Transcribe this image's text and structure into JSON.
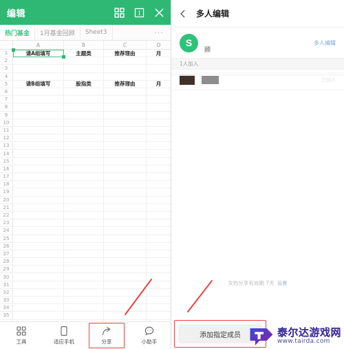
{
  "spreadsheet": {
    "appbar": {
      "title": "编辑",
      "icons": [
        {
          "name": "grid-view-icon",
          "glyph": "grid"
        },
        {
          "name": "sheet-count-icon",
          "label": "1"
        },
        {
          "name": "close-icon",
          "glyph": "x"
        }
      ]
    },
    "tabs": [
      {
        "label": "热门基金",
        "active": true
      },
      {
        "label": "1月基金回顾",
        "active": false
      },
      {
        "label": "Sheet3",
        "active": false
      }
    ],
    "tabs_more": "···",
    "columns": [
      "A",
      "B",
      "C",
      "D"
    ],
    "row_count_visible": 38,
    "selected_cell": "A1",
    "cells": {
      "1": [
        "请A组填写",
        "主题类",
        "推荐理由",
        "月"
      ],
      "5": [
        "请B组填写",
        "股指类",
        "推荐理由",
        "月"
      ]
    },
    "toolbar": [
      {
        "label": "工具",
        "icon": "tools-grid-icon",
        "highlighted": false
      },
      {
        "label": "适应手机",
        "icon": "phone-fit-icon",
        "highlighted": false
      },
      {
        "label": "分享",
        "icon": "share-icon",
        "highlighted": true
      },
      {
        "label": "小助手",
        "icon": "assistant-smiley-icon",
        "highlighted": false
      }
    ]
  },
  "share_panel": {
    "back_icon": "back-chevron-icon",
    "title": "多人编辑",
    "owner": {
      "avatar_letter": "S",
      "name": "顾",
      "action_link": "多人编辑"
    },
    "section_header": "1人加入",
    "member": {
      "status": "已加入"
    },
    "validity": {
      "text": "文档分享有效期 7天",
      "settings_link": "设置"
    },
    "add_member_button": "添加指定成员"
  },
  "watermark": {
    "cn": "泰尔达游戏网",
    "url": "www.tairda.com"
  },
  "colors": {
    "brand_green": "#2fb874",
    "accent_green": "#43c286",
    "annotation_red": "#e8433f",
    "link_blue": "#7aa7e0"
  }
}
